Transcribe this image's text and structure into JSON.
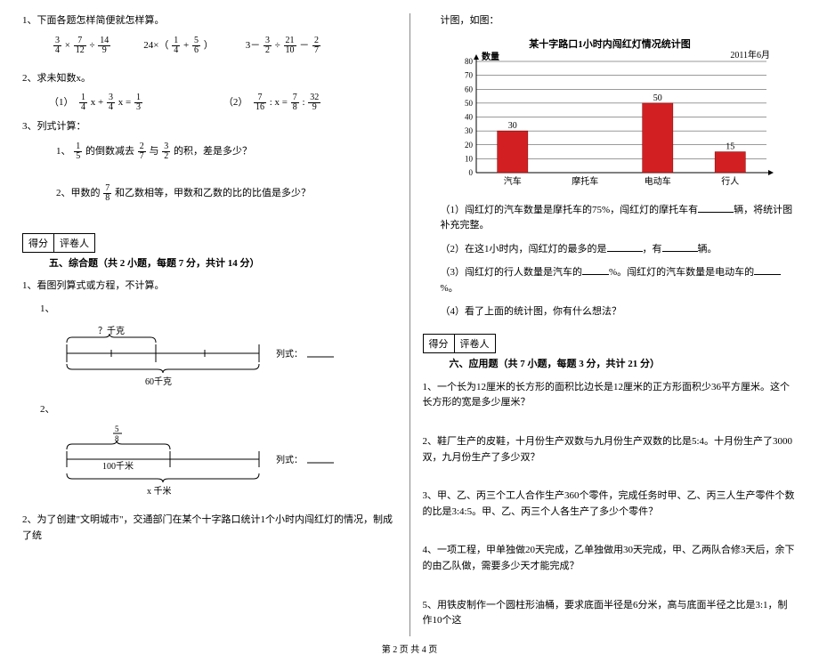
{
  "left": {
    "q1_title": "1、下面各题怎样简便就怎样算。",
    "expr1_a": "3",
    "expr1_b": "4",
    "expr1_c": "7",
    "expr1_d": "12",
    "expr1_e": "14",
    "expr1_f": "9",
    "expr2_pre": "24×（",
    "expr2_a": "1",
    "expr2_b": "4",
    "expr2_c": "5",
    "expr2_d": "6",
    "expr2_post": "）",
    "expr3_pre": "3－",
    "expr3_a": "3",
    "expr3_b": "2",
    "expr3_c": "21",
    "expr3_d": "10",
    "expr3_e": "2",
    "expr3_f": "7",
    "q2_title": "2、求未知数x。",
    "eq1_label": "（1）",
    "eq1": {
      "a": "1",
      "b": "4",
      "c": "3",
      "d": "4",
      "e": "1",
      "f": "3"
    },
    "eq2_label": "（2）",
    "eq2": {
      "a": "7",
      "b": "16",
      "c": "7",
      "d": "8",
      "e": "32",
      "f": "9"
    },
    "q3_title": "3、列式计算：",
    "q3_1_pre": "1、",
    "q3_1_a": "1",
    "q3_1_b": "5",
    "q3_1_mid": "的倒数减去",
    "q3_1_c": "2",
    "q3_1_d": "7",
    "q3_1_mid2": "与",
    "q3_1_e": "3",
    "q3_1_f": "2",
    "q3_1_post": "的积，差是多少？",
    "q3_2_pre": "2、甲数的",
    "q3_2_a": "7",
    "q3_2_b": "8",
    "q3_2_post": "和乙数相等，甲数和乙数的比的比值是多少？",
    "score_label1": "得分",
    "score_label2": "评卷人",
    "sec5_title": "五、综合题（共 2 小题，每题 7 分，共计 14 分）",
    "sub1_title": "1、看图列算式或方程，不计算。",
    "d1_label": "1、",
    "d1_top": "？千克",
    "d1_bottom": "60千克",
    "d1_right": "列式：",
    "d2_label": "2、",
    "d2_top_n": "5",
    "d2_top_d": "8",
    "d2_mid": "100千米",
    "d2_bottom": "x 千米",
    "d2_right": "列式：",
    "sub2_title": "2、为了创建\"文明城市\"，交通部门在某个十字路口统计1个小时内闯红灯的情况，制成了统"
  },
  "right": {
    "intro": "计图，如图：",
    "chart_title": "某十字路口1小时内闯红灯情况统计图",
    "chart_date": "2011年6月",
    "ylabel": "数量",
    "q_a": "（1）闯红灯的汽车数量是摩托车的75%，闯红灯的摩托车有",
    "q_a_post": "辆，将统计图补充完整。",
    "q_b": "（2）在这1小时内，闯红灯的最多的是",
    "q_b_mid": "，有",
    "q_b_post": "辆。",
    "q_c": "（3）闯红灯的行人数量是汽车的",
    "q_c_mid": "%。闯红灯的汽车数量是电动车的",
    "q_c_post": "%。",
    "q_d": "（4）看了上面的统计图，你有什么想法？",
    "sec6_title": "六、应用题（共 7 小题，每题 3 分，共计 21 分）",
    "a1": "1、一个长为12厘米的长方形的面积比边长是12厘米的正方形面积少36平方厘米。这个长方形的宽是多少厘米？",
    "a2": "2、鞋厂生产的皮鞋，十月份生产双数与九月份生产双数的比是5:4。十月份生产了3000双，九月份生产了多少双？",
    "a3": "3、甲、乙、丙三个工人合作生产360个零件，完成任务时甲、乙、丙三人生产零件个数的比是3:4:5。甲、乙、丙三个人各生产了多少个零件？",
    "a4": "4、一项工程，甲单独做20天完成，乙单独做用30天完成，甲、乙两队合修3天后，余下的由乙队做，需要多少天才能完成？",
    "a5": "5、用铁皮制作一个圆柱形油桶，要求底面半径是6分米，高与底面半径之比是3:1，制作10个这"
  },
  "footer": "第 2 页  共 4 页",
  "chart_data": {
    "type": "bar",
    "title": "某十字路口1小时内闯红灯情况统计图",
    "subtitle": "2011年6月",
    "ylabel": "数量",
    "categories": [
      "汽车",
      "摩托车",
      "电动车",
      "行人"
    ],
    "values": [
      30,
      null,
      50,
      15
    ],
    "data_labels": [
      30,
      null,
      50,
      15
    ],
    "ylim": [
      0,
      80
    ],
    "yticks": [
      0,
      10,
      20,
      30,
      40,
      50,
      60,
      70,
      80
    ],
    "bar_color": "#d22022"
  }
}
